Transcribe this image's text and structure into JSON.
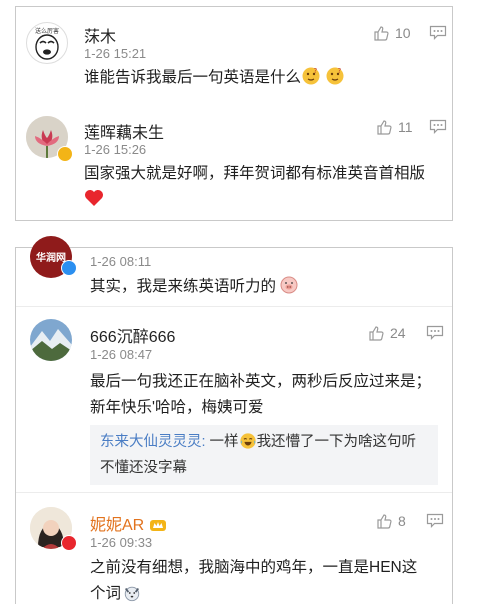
{
  "card1": {
    "comments": [
      {
        "avatar": "meme-face-avatar",
        "avatar_caption": "送么厉害",
        "name": "莯木",
        "time": "1-26 15:21",
        "text": "谁能告诉我最后一句英语是什么",
        "likes": "10"
      },
      {
        "avatar": "lotus-avatar",
        "name": "莲晖藕未生",
        "time": "1-26 15:26",
        "text": "国家强大就是好啊，拜年贺词都有标准英音首相版",
        "likes": "11"
      }
    ]
  },
  "card2": {
    "comments": [
      {
        "avatar": "brand-logo-avatar",
        "avatar_caption": "华润网",
        "time": "1-26 08:11",
        "text": "其实，我是来练英语听力的"
      },
      {
        "avatar": "mountain-avatar",
        "name": "666沉醉666",
        "time": "1-26 08:47",
        "text_line1": "最后一句我还正在脑补英文，两秒后反应过来是；",
        "text_line2": "新年快乐'哈哈，梅姨可爱",
        "likes": "24",
        "reply": {
          "author": "东来大仙灵灵灵:",
          "text_before": " 一样",
          "text_after": "我还懵了一下为啥这句听",
          "text_line2": "不懂还没字幕"
        }
      },
      {
        "avatar": "girl-avatar",
        "name": "妮妮AR",
        "time": "1-26 09:33",
        "text_line1": "之前没有细想，我脑海中的鸡年，一直是HEN这",
        "text_line2": "个词",
        "likes": "8"
      }
    ]
  },
  "colors": {
    "link_blue": "#4a7dc4",
    "muted_gray": "#8a8a8a",
    "heart_red": "#e8262d",
    "vip_gold": "#f3b417",
    "verified_blue": "#2b8ff0"
  }
}
